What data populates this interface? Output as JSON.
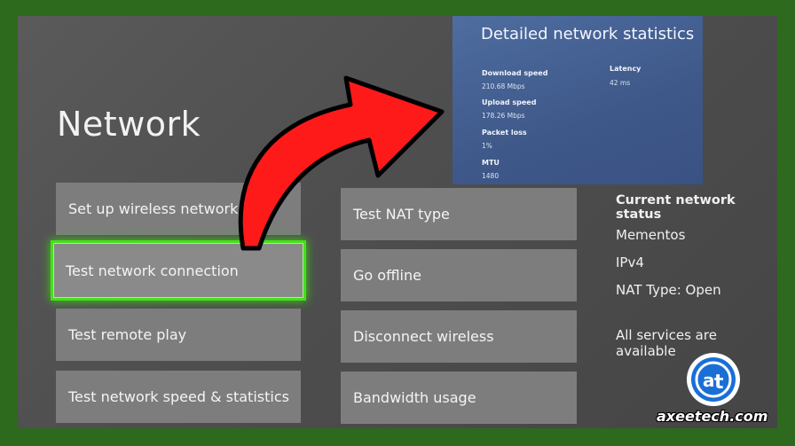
{
  "page": {
    "title": "Network"
  },
  "tiles_left": [
    {
      "label": "Set up wireless network"
    },
    {
      "label": "Test network connection"
    },
    {
      "label": "Test remote play"
    },
    {
      "label": "Test network speed & statistics"
    }
  ],
  "tiles_right": [
    {
      "label": "Test NAT type"
    },
    {
      "label": "Go offline"
    },
    {
      "label": "Disconnect wireless"
    },
    {
      "label": "Bandwidth usage"
    }
  ],
  "status": {
    "title": "Current network status",
    "network_name": "Mementos",
    "ip_version": "IPv4",
    "nat_type": "NAT Type: Open",
    "services": "All services are available"
  },
  "stats": {
    "title": "Detailed network statistics",
    "download_label": "Download speed",
    "download_value": "210.68 Mbps",
    "upload_label": "Upload speed",
    "upload_value": "178.26 Mbps",
    "packet_loss_label": "Packet loss",
    "packet_loss_value": "1%",
    "mtu_label": "MTU",
    "mtu_value": "1480",
    "latency_label": "Latency",
    "latency_value": "42 ms"
  },
  "watermark": {
    "site": "axeetech.com"
  },
  "colors": {
    "focus_glow": "#45e01a",
    "arrow": "#ff1a1a",
    "frame": "#2d6a1e",
    "overlay_bg": "#4a6698"
  },
  "icons": {
    "arrow": "curved-arrow-icon",
    "logo": "axeetech-logo-icon"
  }
}
